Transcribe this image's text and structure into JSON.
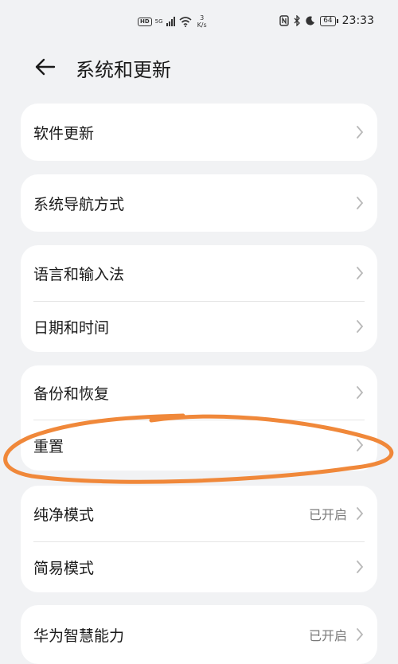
{
  "status": {
    "hd": "HD",
    "net": "5G",
    "speed_num": "3",
    "speed_unit": "K/s",
    "battery": "64",
    "time": "23:33",
    "icons": [
      "nfc-icon",
      "bluetooth-icon",
      "moon-icon"
    ]
  },
  "header": {
    "title": "系统和更新"
  },
  "cards": [
    {
      "rows": [
        {
          "label": "软件更新",
          "value": ""
        }
      ]
    },
    {
      "rows": [
        {
          "label": "系统导航方式",
          "value": ""
        }
      ]
    },
    {
      "rows": [
        {
          "label": "语言和输入法",
          "value": ""
        },
        {
          "label": "日期和时间",
          "value": ""
        }
      ]
    },
    {
      "rows": [
        {
          "label": "备份和恢复",
          "value": ""
        },
        {
          "label": "重置",
          "value": ""
        }
      ]
    },
    {
      "rows": [
        {
          "label": "纯净模式",
          "value": "已开启"
        },
        {
          "label": "简易模式",
          "value": ""
        }
      ]
    },
    {
      "rows": [
        {
          "label": "华为智慧能力",
          "value": "已开启"
        }
      ]
    }
  ],
  "colors": {
    "annotation": "#f0883a",
    "background": "#f1f2f4"
  }
}
